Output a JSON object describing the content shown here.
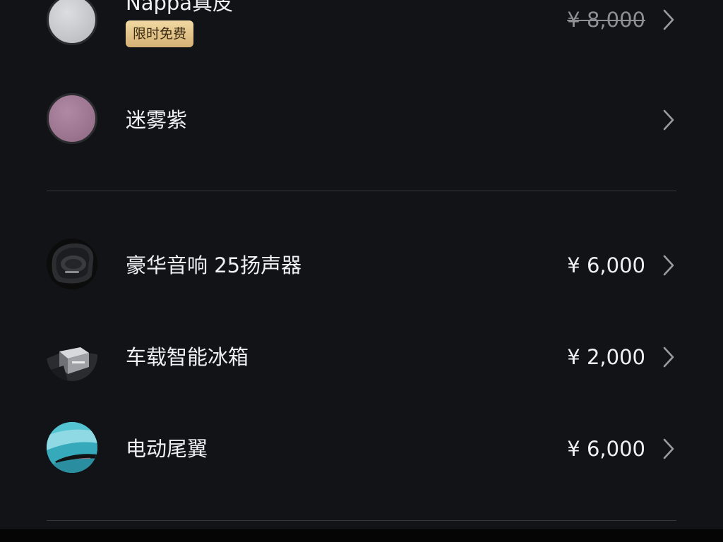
{
  "options": [
    {
      "label": "Nappa真皮",
      "price": "¥ 8,000",
      "badge": "限时免费",
      "swatch_color": "#c9cacc",
      "price_struck": true
    },
    {
      "label": "迷雾紫",
      "price": "",
      "swatch_color": "#a07a94"
    },
    {
      "label": "豪华音响 25扬声器",
      "price": "¥ 6,000",
      "image": "speaker-photo"
    },
    {
      "label": "车载智能冰箱",
      "price": "¥ 2,000",
      "image": "fridge-photo"
    },
    {
      "label": "电动尾翼",
      "price": "¥ 6,000",
      "image": "spoiler-photo"
    }
  ],
  "colors": {
    "background": "#111317",
    "text": "#f0f0f2",
    "muted_price": "#8d8f95",
    "badge_gold": "#e5c68d",
    "divider": "#34363b",
    "chevron": "#9a9ca2"
  }
}
